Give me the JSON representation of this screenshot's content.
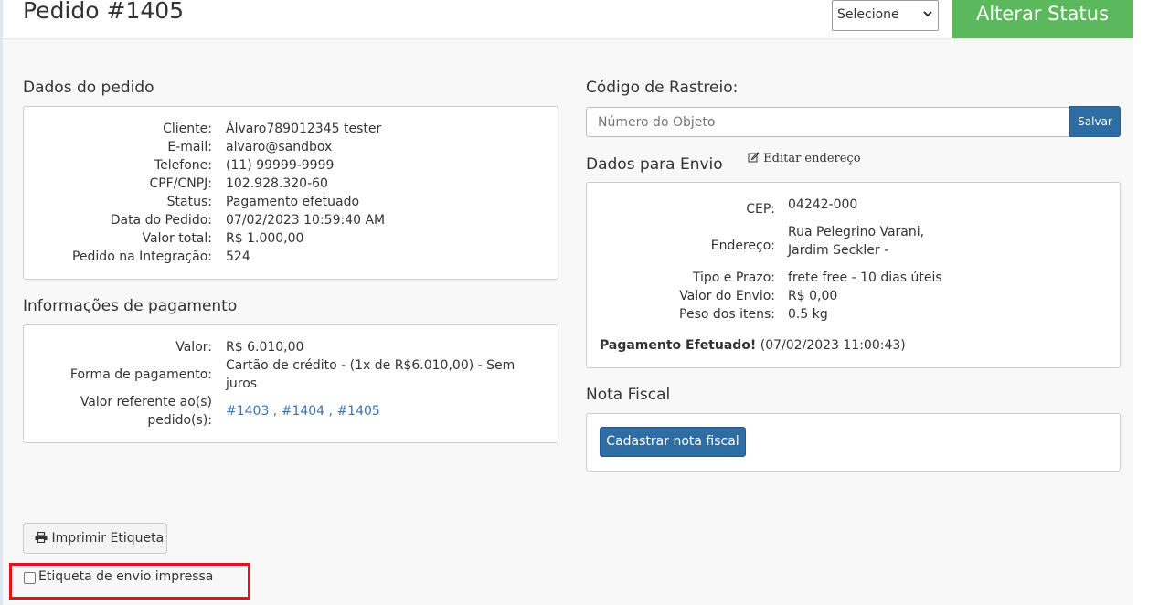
{
  "header": {
    "title": "Pedido #1405",
    "status_select_value": "Selecione",
    "alter_status_label": "Alterar Status"
  },
  "dados_pedido": {
    "title": "Dados do pedido",
    "rows": [
      {
        "label": "Cliente:",
        "value": "Álvaro789012345 tester"
      },
      {
        "label": "E-mail:",
        "value": "alvaro@sandbox"
      },
      {
        "label": "Telefone:",
        "value": "(11) 99999-9999"
      },
      {
        "label": "CPF/CNPJ:",
        "value": "102.928.320-60"
      },
      {
        "label": "Status:",
        "value": "Pagamento efetuado"
      },
      {
        "label": "Data do Pedido:",
        "value": "07/02/2023 10:59:40 AM"
      },
      {
        "label": "Valor total:",
        "value": "R$ 1.000,00"
      },
      {
        "label": "Pedido na Integração:",
        "value": "524"
      }
    ]
  },
  "pagamento": {
    "title": "Informações de pagamento",
    "valor_label": "Valor:",
    "valor": "R$ 6.010,00",
    "forma_label": "Forma de pagamento:",
    "forma_line1": "Cartão de crédito - (1x de R$6.010,00) - Sem",
    "forma_line2": "juros",
    "ref_label_line1": "Valor referente ao(s)",
    "ref_label_line2": "pedido(s):",
    "ref_links": [
      "#1403",
      "#1404",
      "#1405"
    ],
    "ref_separator": " , "
  },
  "rastreio": {
    "title": "Código de Rastreio:",
    "placeholder": "Número do Objeto",
    "save_label": "Salvar"
  },
  "envio": {
    "title": "Dados para Envio",
    "edit_label": "Editar endereço",
    "cep_label": "CEP:",
    "cep": "04242-000",
    "endereco_label": "Endereço:",
    "endereco_line1": "Rua Pelegrino Varani,",
    "endereco_line2": "Jardim Seckler -",
    "tipo_label": "Tipo e Prazo:",
    "tipo": "frete free - 10 dias úteis",
    "valor_label": "Valor do Envio:",
    "valor": "R$ 0,00",
    "peso_label": "Peso dos itens:",
    "peso": "0.5 kg",
    "pago_label": "Pagamento Efetuado!",
    "pago_date": "(07/02/2023 11:00:43)"
  },
  "nota_fiscal": {
    "title": "Nota Fiscal",
    "button_label": "Cadastrar nota fiscal"
  },
  "etiqueta": {
    "print_label": "Imprimir Etiqueta",
    "checkbox_label": "Etiqueta de envio impressa"
  },
  "colors": {
    "alter_status_bg": "#5cb85c",
    "primary_blue": "#2e6da4",
    "link": "#3b73af",
    "highlight_red": "#e0131e"
  },
  "icons": [
    "chevron-down-icon",
    "edit-icon",
    "printer-icon"
  ]
}
